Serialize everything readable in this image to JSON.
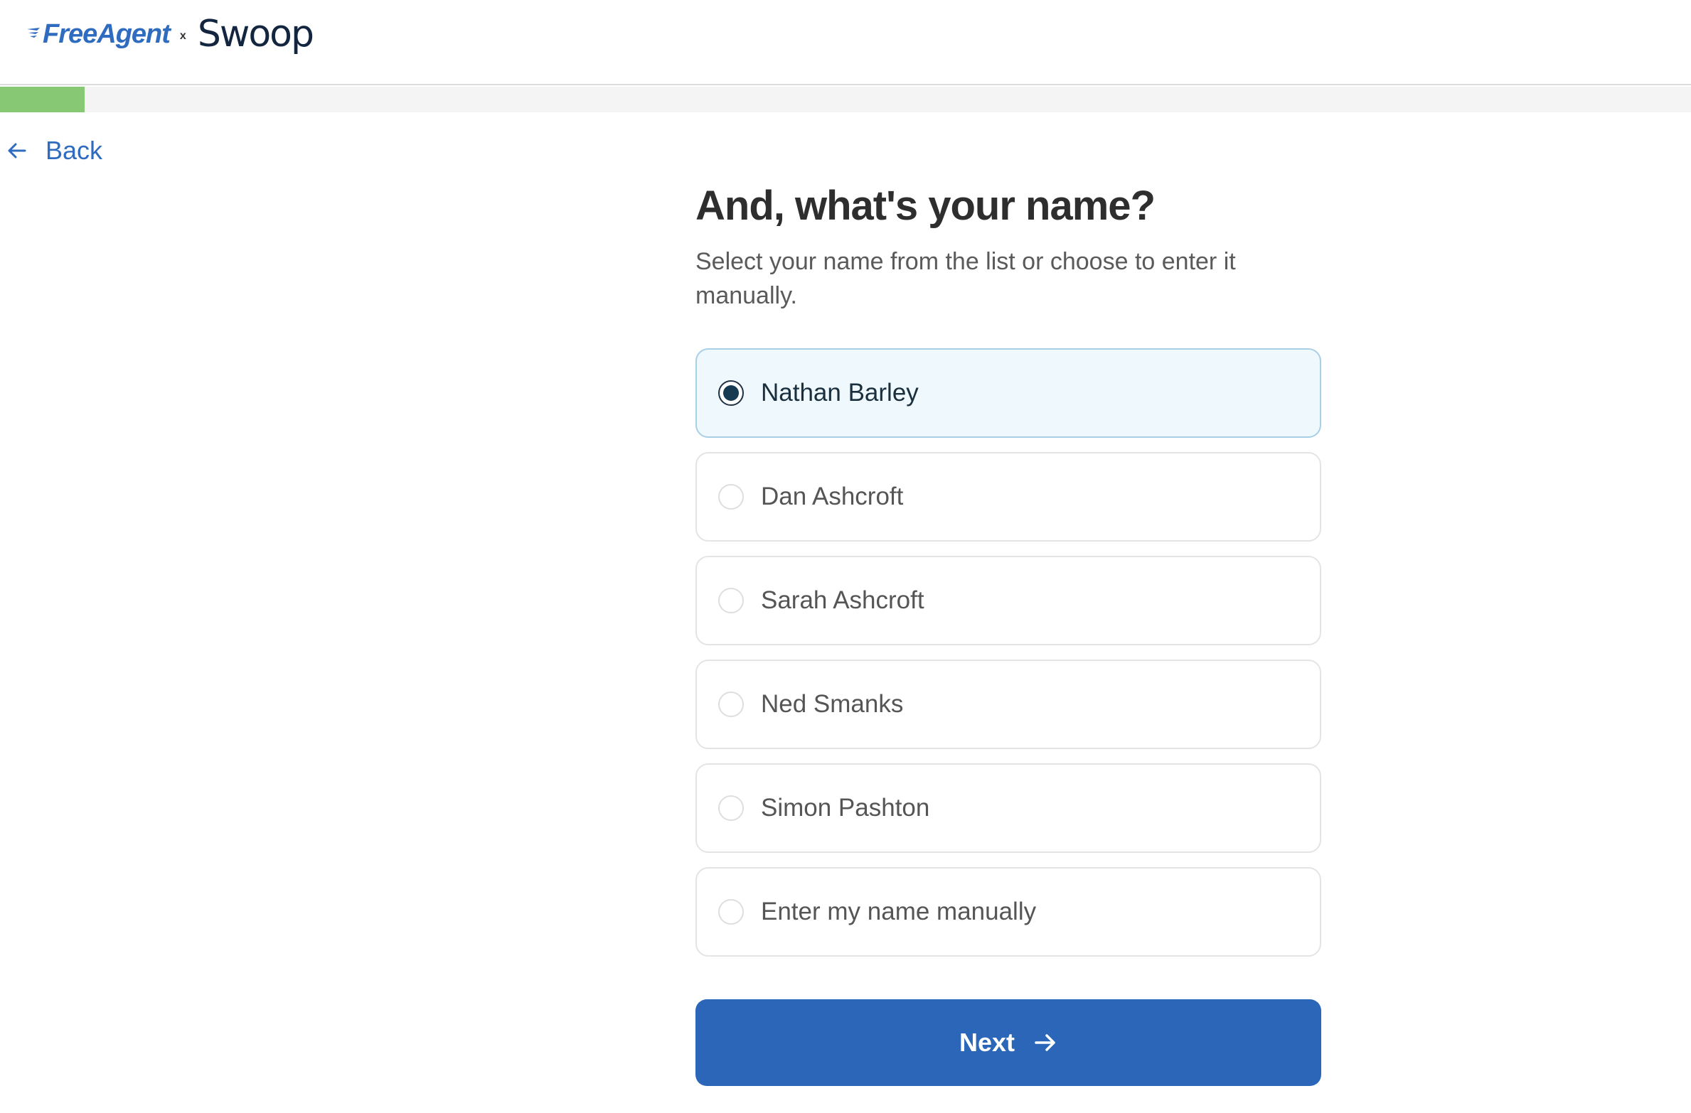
{
  "header": {
    "brand_primary": "FreeAgent",
    "brand_separator": "x",
    "brand_partner": "Swoop"
  },
  "progress": {
    "value_fraction": 0.05,
    "color": "#86c873"
  },
  "nav": {
    "back_label": "Back",
    "back_icon": "arrow-left-icon"
  },
  "main": {
    "title": "And, what's your name?",
    "subtitle": "Select your name from the list or choose to enter it manually."
  },
  "options": [
    {
      "label": "Nathan Barley",
      "selected": true
    },
    {
      "label": "Dan Ashcroft",
      "selected": false
    },
    {
      "label": "Sarah Ashcroft",
      "selected": false
    },
    {
      "label": "Ned Smanks",
      "selected": false
    },
    {
      "label": "Simon Pashton",
      "selected": false
    },
    {
      "label": "Enter my name manually",
      "selected": false
    }
  ],
  "actions": {
    "next_label": "Next",
    "next_icon": "arrow-right-icon"
  },
  "colors": {
    "accent": "#2b66b8",
    "link": "#2f6cc0",
    "selected_bg": "#eff8fd",
    "selected_border": "#a9cfe6"
  }
}
